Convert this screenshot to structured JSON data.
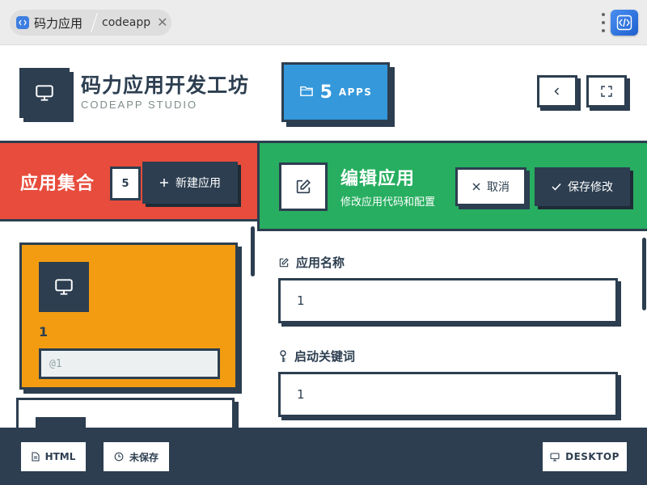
{
  "tabs": {
    "app_title": "码力应用",
    "second_title": "codeapp",
    "close_glyph": "✕"
  },
  "header": {
    "title": "码力应用开发工坊",
    "subtitle": "CODEAPP STUDIO",
    "apps_count": "5",
    "apps_label": "APPS"
  },
  "left": {
    "title": "应用集合",
    "count": "5",
    "new_button": "新建应用",
    "cards": [
      {
        "name": "1",
        "keyword": "@1"
      }
    ]
  },
  "editor": {
    "title": "编辑应用",
    "subtitle": "修改应用代码和配置",
    "cancel": "取消",
    "save": "保存修改",
    "fields": [
      {
        "label": "应用名称",
        "value": "1"
      },
      {
        "label": "启动关键词",
        "value": "1"
      }
    ]
  },
  "footer": {
    "html": "HTML",
    "status": "未保存",
    "mode": "DESKTOP"
  },
  "colors": {
    "dark": "#2c3e50",
    "red": "#e74c3c",
    "green": "#27ae60",
    "blue": "#3498db",
    "orange": "#f39c12"
  }
}
